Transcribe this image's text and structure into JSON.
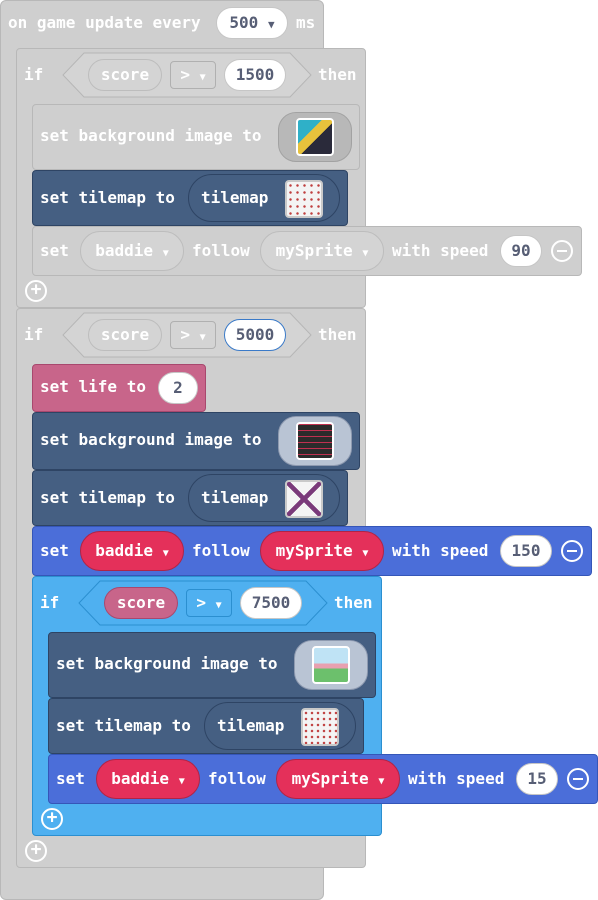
{
  "event": {
    "label_prefix": "on game update every",
    "interval": "500",
    "label_suffix": "ms"
  },
  "if1": {
    "if_label": "if",
    "var": "score",
    "op": ">",
    "value": "1500",
    "then_label": "then",
    "set_bg_label": "set background image to",
    "set_tilemap_label": "set tilemap to",
    "tilemap_value": "tilemap",
    "follow": {
      "set_label": "set",
      "sprite": "baddie",
      "follow_label": "follow",
      "target": "mySprite",
      "speed_label": "with speed",
      "speed": "90"
    }
  },
  "if2": {
    "if_label": "if",
    "var": "score",
    "op": ">",
    "value": "5000",
    "then_label": "then",
    "set_life_label": "set life to",
    "life_value": "2",
    "set_bg_label": "set background image to",
    "set_tilemap_label": "set tilemap to",
    "tilemap_value": "tilemap",
    "follow": {
      "set_label": "set",
      "sprite": "baddie",
      "follow_label": "follow",
      "target": "mySprite",
      "speed_label": "with speed",
      "speed": "150"
    }
  },
  "if3": {
    "if_label": "if",
    "var": "score",
    "op": ">",
    "value": "7500",
    "then_label": "then",
    "set_bg_label": "set background image to",
    "set_tilemap_label": "set tilemap to",
    "tilemap_value": "tilemap",
    "follow": {
      "set_label": "set",
      "sprite": "baddie",
      "follow_label": "follow",
      "target": "mySprite",
      "speed_label": "with speed",
      "speed": "15"
    }
  },
  "icons": {
    "dropdown": "dropdown-arrow-icon",
    "add": "add-icon",
    "remove": "remove-icon"
  },
  "colors": {
    "event_gray": "#cfcfcf",
    "scene_dark": "#455f82",
    "info_pink": "#c8658a",
    "sprite_blue": "#4b6ed9",
    "logic_blue": "#4fb0f0",
    "variable_red": "#e4305a"
  }
}
